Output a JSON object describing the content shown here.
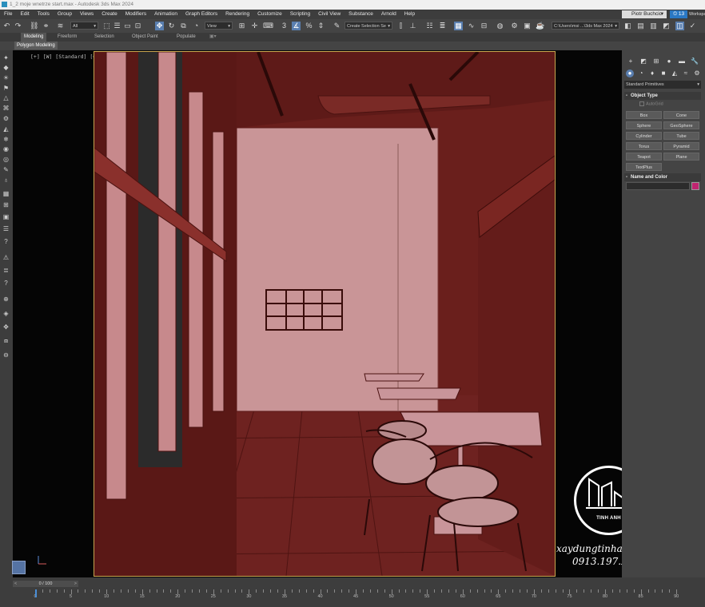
{
  "window": {
    "title": "1_2 moje wnetrze start.max - Autodesk 3ds Max 2024"
  },
  "menu": [
    "File",
    "Edit",
    "Tools",
    "Group",
    "Views",
    "Create",
    "Modifiers",
    "Animation",
    "Graph Editors",
    "Rendering",
    "Customize",
    "Scripting",
    "Civil View",
    "Substance",
    "Arnold",
    "Help"
  ],
  "account": {
    "user": "Piotr Buchcic",
    "counter": "13",
    "workspaces": "Workspaces"
  },
  "toolbar": {
    "selection_filter": "All",
    "ref_coord": "View",
    "selection_set": "Create Selection Se",
    "project_path": "C:\\Users\\msi ...\\3ds Max 2024"
  },
  "ribbon": {
    "tabs": [
      "Modeling",
      "Freeform",
      "Selection",
      "Object Paint",
      "Populate"
    ],
    "active_tab": "Modeling",
    "sub_tab": "Polygon Modeling"
  },
  "viewport": {
    "label": "[+] [W] [Standard] [Clay + Edged Faces]",
    "filter_icon": "funnel-icon"
  },
  "command_panel": {
    "category": "Standard Primitives",
    "object_type_title": "Object Type",
    "autogrid": "AutoGrid",
    "primitives": [
      "Box",
      "Cone",
      "Sphere",
      "GeoSphere",
      "Cylinder",
      "Tube",
      "Torus",
      "Pyramid",
      "Teapot",
      "Plane",
      "TextPlus"
    ],
    "name_color_title": "Name and Color",
    "object_color": "#c02470"
  },
  "timeline": {
    "frame_display": "0 / 100",
    "ticks": [
      0,
      5,
      10,
      15,
      20,
      25,
      30,
      35,
      40,
      45,
      50,
      55,
      60,
      65,
      70,
      75,
      80,
      85,
      90
    ]
  },
  "watermark": {
    "brand": "TINH ANH",
    "website": "xaydungtinhanh.com",
    "phone": "0913.197.234"
  },
  "colors": {
    "clay": "#6a1f1c",
    "back_wall": "#c99597",
    "selected_tool": "#5a7fb0"
  }
}
